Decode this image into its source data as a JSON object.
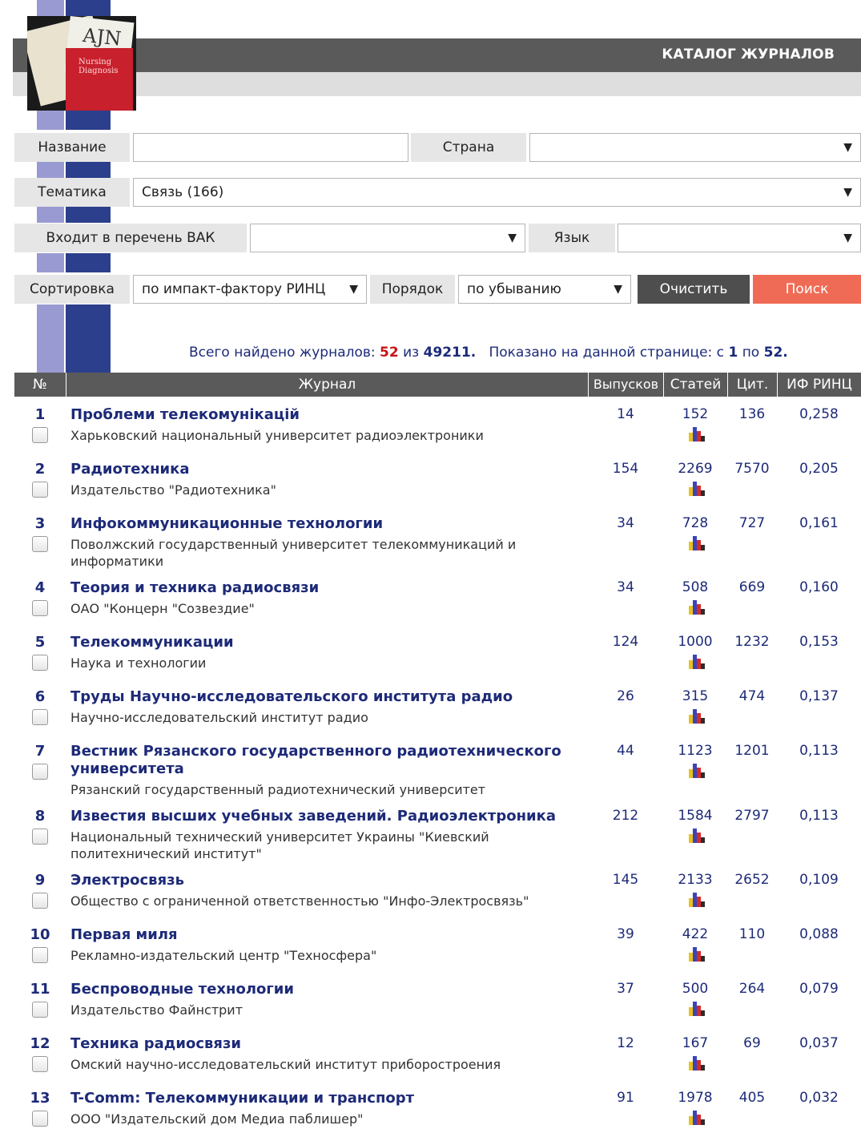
{
  "header": {
    "title": "КАТАЛОГ ЖУРНАЛОВ",
    "logo_text": "AJN",
    "logo_cover_text": "Nursing Diagnosis"
  },
  "filters": {
    "name_label": "Название",
    "name_value": "",
    "country_label": "Страна",
    "country_value": "",
    "topic_label": "Тематика",
    "topic_value": "Связь  (166)",
    "vak_label": "Входит в перечень ВАК",
    "vak_value": "",
    "language_label": "Язык",
    "language_value": "",
    "sort_label": "Сортировка",
    "sort_value": "по импакт-фактору РИНЦ",
    "order_label": "Порядок",
    "order_value": "по убыванию",
    "clear_label": "Очистить",
    "search_label": "Поиск",
    "dropdown_arrow": "▼"
  },
  "summary": {
    "found_prefix": "Всего найдено журналов:",
    "found": "52",
    "of": "из",
    "total": "49211.",
    "shown_prefix": "Показано на данной странице: с",
    "from": "1",
    "to_word": "по",
    "to": "52."
  },
  "table": {
    "headers": {
      "num": "№",
      "journal": "Журнал",
      "issues": "Выпусков",
      "articles": "Статей",
      "citations": "Цит.",
      "if": "ИФ РИНЦ"
    },
    "rows": [
      {
        "num": "1",
        "title": "Проблеми телекомунікацій",
        "publisher": "Харьковский национальный университет радиоэлектроники",
        "issues": "14",
        "articles": "152",
        "citations": "136",
        "if": "0,258"
      },
      {
        "num": "2",
        "title": "Радиотехника",
        "publisher": "Издательство \"Радиотехника\"",
        "issues": "154",
        "articles": "2269",
        "citations": "7570",
        "if": "0,205"
      },
      {
        "num": "3",
        "title": "Инфокоммуникационные технологии",
        "publisher": "Поволжский государственный университет телекоммуникаций и информатики",
        "issues": "34",
        "articles": "728",
        "citations": "727",
        "if": "0,161"
      },
      {
        "num": "4",
        "title": "Теория и техника радиосвязи",
        "publisher": "ОАО \"Концерн \"Созвездие\"",
        "issues": "34",
        "articles": "508",
        "citations": "669",
        "if": "0,160"
      },
      {
        "num": "5",
        "title": "Телекоммуникации",
        "publisher": "Наука и технологии",
        "issues": "124",
        "articles": "1000",
        "citations": "1232",
        "if": "0,153"
      },
      {
        "num": "6",
        "title": "Труды Научно-исследовательского института радио",
        "publisher": "Научно-исследовательский институт радио",
        "issues": "26",
        "articles": "315",
        "citations": "474",
        "if": "0,137"
      },
      {
        "num": "7",
        "title": "Вестник Рязанского государственного радиотехнического университета",
        "publisher": "Рязанский государственный радиотехнический университет",
        "issues": "44",
        "articles": "1123",
        "citations": "1201",
        "if": "0,113"
      },
      {
        "num": "8",
        "title": "Известия высших учебных заведений. Радиоэлектроника",
        "publisher": "Национальный технический университет Украины \"Киевский политехнический институт\"",
        "issues": "212",
        "articles": "1584",
        "citations": "2797",
        "if": "0,113"
      },
      {
        "num": "9",
        "title": "Электросвязь",
        "publisher": "Общество с ограниченной ответственностью \"Инфо-Электросвязь\"",
        "issues": "145",
        "articles": "2133",
        "citations": "2652",
        "if": "0,109"
      },
      {
        "num": "10",
        "title": "Первая миля",
        "publisher": "Рекламно-издательский центр \"Техносфера\"",
        "issues": "39",
        "articles": "422",
        "citations": "110",
        "if": "0,088"
      },
      {
        "num": "11",
        "title": "Беспроводные технологии",
        "publisher": "Издательство Файнстрит",
        "issues": "37",
        "articles": "500",
        "citations": "264",
        "if": "0,079"
      },
      {
        "num": "12",
        "title": "Техника радиосвязи",
        "publisher": "Омский научно-исследовательский институт приборостроения",
        "issues": "12",
        "articles": "167",
        "citations": "69",
        "if": "0,037"
      },
      {
        "num": "13",
        "title": "T-Comm: Телекоммуникации и транспорт",
        "publisher": "ООО \"Издательский дом Медиа паблишер\"",
        "issues": "91",
        "articles": "1978",
        "citations": "405",
        "if": "0,032"
      }
    ]
  },
  "colors": {
    "title_blue": "#1d2a78",
    "count_red": "#c81414",
    "search_button": "#f06b55",
    "header_bar": "#5a5a5a",
    "icon": "bar-chart-icon"
  }
}
